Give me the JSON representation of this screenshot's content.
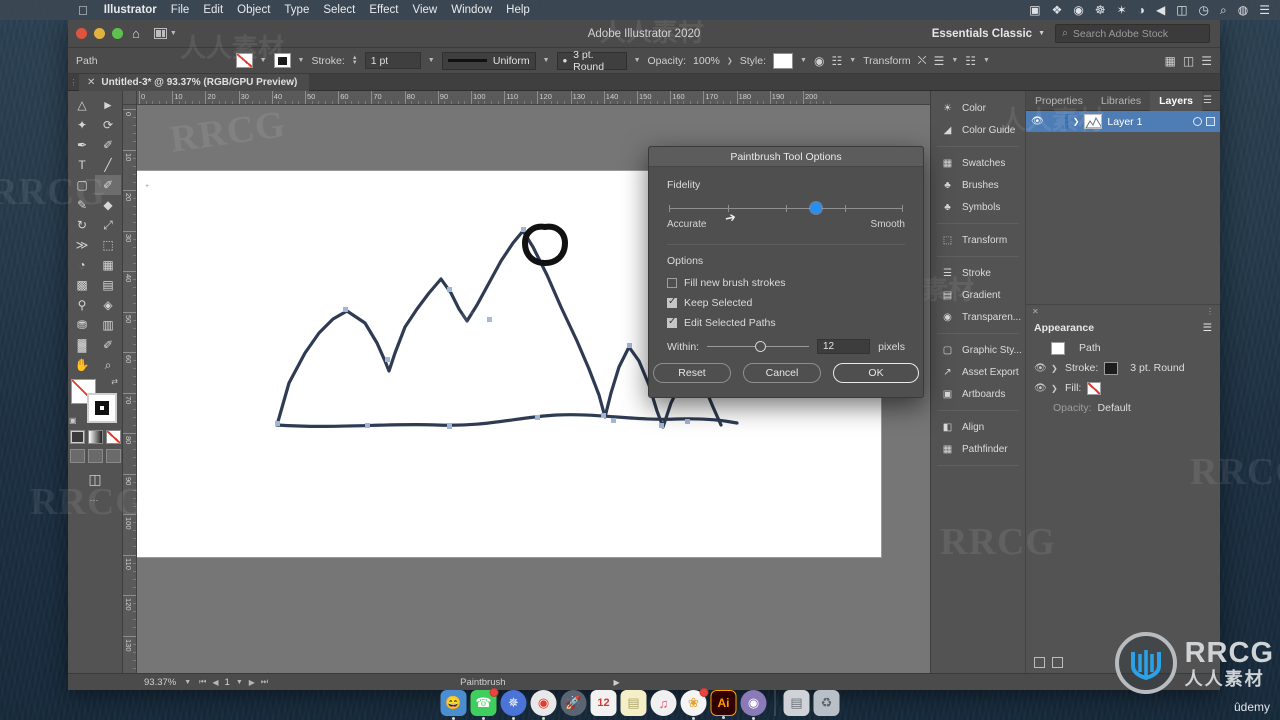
{
  "menubar": {
    "apple_icon": "apple-icon",
    "items": [
      {
        "label": "Illustrator",
        "bold": true
      },
      {
        "label": "File",
        "bold": false
      },
      {
        "label": "Edit",
        "bold": false
      },
      {
        "label": "Object",
        "bold": false
      },
      {
        "label": "Type",
        "bold": false
      },
      {
        "label": "Select",
        "bold": false
      },
      {
        "label": "Effect",
        "bold": false
      },
      {
        "label": "View",
        "bold": false
      },
      {
        "label": "Window",
        "bold": false
      },
      {
        "label": "Help",
        "bold": false
      }
    ],
    "status_icons": [
      {
        "name": "screen-record-icon",
        "glyph": "■"
      },
      {
        "name": "dropbox-icon",
        "glyph": "❖"
      },
      {
        "name": "app-icon",
        "glyph": "●"
      },
      {
        "name": "spiral-icon",
        "glyph": "◎"
      },
      {
        "name": "bluetooth-icon",
        "glyph": "✶"
      },
      {
        "name": "wifi-icon",
        "glyph": "◗"
      },
      {
        "name": "volume-icon",
        "glyph": "◀"
      },
      {
        "name": "battery-icon",
        "glyph": "▭"
      },
      {
        "name": "clock-icon",
        "glyph": "◷"
      },
      {
        "name": "search-icon",
        "glyph": "⌕"
      },
      {
        "name": "siri-icon",
        "glyph": "◍"
      },
      {
        "name": "control-center-icon",
        "glyph": "☰"
      }
    ]
  },
  "titlebar": {
    "title": "Adobe Illustrator 2020",
    "workspace": "Essentials Classic",
    "search_placeholder": "Search Adobe Stock",
    "home_icon": "home-icon",
    "arrange_icon": "arrange-documents-icon"
  },
  "controlbar": {
    "selection_label": "Path",
    "fill_swatch": "fill-none-swatch",
    "stroke_swatch": "stroke-black-swatch",
    "stroke_label": "Stroke:",
    "stroke_weight": "1 pt",
    "profile_label": "Uniform",
    "brush_label": "3 pt. Round",
    "opacity_label": "Opacity:",
    "opacity_value": "100%",
    "style_label": "Style:",
    "transform_label": "Transform",
    "recolor_icon": "recolor-artwork-icon",
    "select_similar_icon": "select-similar-icon",
    "align_icon": "align-icon",
    "distribute_icon": "distribute-icon",
    "arrange_icon": "arrange-icon",
    "more_options_icon": "more-options-icon"
  },
  "doctab": {
    "close_icon": "close-tab-icon",
    "label": "Untitled-3* @ 93.37% (RGB/GPU Preview)"
  },
  "toolbar": {
    "tools": [
      {
        "name": "selection-tool",
        "glyph": "◤"
      },
      {
        "name": "direct-selection-tool",
        "glyph": "◥"
      },
      {
        "name": "magic-wand-tool",
        "glyph": "✦"
      },
      {
        "name": "lasso-tool",
        "glyph": "◠"
      },
      {
        "name": "pen-tool",
        "glyph": "✒"
      },
      {
        "name": "curvature-tool",
        "glyph": "✐"
      },
      {
        "name": "type-tool",
        "glyph": "T"
      },
      {
        "name": "line-segment-tool",
        "glyph": "╱"
      },
      {
        "name": "rectangle-tool",
        "glyph": "▭"
      },
      {
        "name": "paintbrush-tool",
        "glyph": "🖌"
      },
      {
        "name": "shaper-tool",
        "glyph": "✎"
      },
      {
        "name": "eraser-tool",
        "glyph": "◆"
      },
      {
        "name": "rotate-tool",
        "glyph": "↻"
      },
      {
        "name": "scale-tool",
        "glyph": "⤡"
      },
      {
        "name": "width-tool",
        "glyph": "≶"
      },
      {
        "name": "free-transform-tool",
        "glyph": "⬚"
      },
      {
        "name": "shape-builder-tool",
        "glyph": "◔"
      },
      {
        "name": "perspective-grid-tool",
        "glyph": "▦"
      },
      {
        "name": "mesh-tool",
        "glyph": "▩"
      },
      {
        "name": "gradient-tool",
        "glyph": "▤"
      },
      {
        "name": "eyedropper-tool",
        "glyph": "⚲"
      },
      {
        "name": "blend-tool",
        "glyph": "◉"
      },
      {
        "name": "symbol-sprayer-tool",
        "glyph": "⚱"
      },
      {
        "name": "column-graph-tool",
        "glyph": "▥"
      },
      {
        "name": "artboard-tool",
        "glyph": "⬓"
      },
      {
        "name": "slice-tool",
        "glyph": "✂"
      },
      {
        "name": "hand-tool",
        "glyph": "✋"
      },
      {
        "name": "zoom-tool",
        "glyph": "⌕"
      }
    ],
    "active_tool": "paintbrush-tool",
    "fill_stroke": {
      "fill_name": "fill-none-indicator",
      "stroke_name": "stroke-black-indicator",
      "swap_icon": "swap-fill-stroke-icon",
      "default_icon": "default-fill-stroke-icon"
    },
    "color_modes": [
      {
        "name": "color-mode-button"
      },
      {
        "name": "gradient-mode-button"
      },
      {
        "name": "none-mode-button"
      }
    ],
    "drawing_modes": [
      {
        "name": "draw-normal-button"
      },
      {
        "name": "draw-behind-button"
      },
      {
        "name": "draw-inside-button"
      }
    ],
    "screen_mode_icon": "change-screen-mode-icon",
    "edit_toolbar_icon": "edit-toolbar-dots-icon"
  },
  "rulers": {
    "top_ticks": [
      "0",
      "10",
      "20",
      "30",
      "40",
      "50",
      "60",
      "70",
      "80",
      "90",
      "100",
      "110",
      "120",
      "130",
      "140",
      "150",
      "160",
      "170",
      "180",
      "190",
      "200"
    ],
    "left_ticks": [
      "0",
      "10",
      "20",
      "30",
      "40",
      "50",
      "60",
      "70",
      "80",
      "90",
      "100",
      "110",
      "120",
      "130"
    ]
  },
  "artboard": {
    "origin_marker": "+",
    "artwork_name": "mountain-landscape-path",
    "zoom": "93.37%"
  },
  "icon_dock": {
    "groups": [
      [
        {
          "label": "Color",
          "icon": "color-panel-icon"
        },
        {
          "label": "Color Guide",
          "icon": "color-guide-panel-icon"
        }
      ],
      [
        {
          "label": "Swatches",
          "icon": "swatches-panel-icon"
        },
        {
          "label": "Brushes",
          "icon": "brushes-panel-icon"
        },
        {
          "label": "Symbols",
          "icon": "symbols-panel-icon"
        }
      ],
      [
        {
          "label": "Transform",
          "icon": "transform-panel-icon"
        }
      ],
      [
        {
          "label": "Stroke",
          "icon": "stroke-panel-icon"
        },
        {
          "label": "Gradient",
          "icon": "gradient-panel-icon"
        },
        {
          "label": "Transparen...",
          "icon": "transparency-panel-icon"
        }
      ],
      [
        {
          "label": "Graphic Sty...",
          "icon": "graphic-styles-panel-icon"
        },
        {
          "label": "Asset Export",
          "icon": "asset-export-panel-icon"
        },
        {
          "label": "Artboards",
          "icon": "artboards-panel-icon"
        }
      ],
      [
        {
          "label": "Align",
          "icon": "align-panel-icon"
        },
        {
          "label": "Pathfinder",
          "icon": "pathfinder-panel-icon"
        }
      ]
    ]
  },
  "layers_panel": {
    "tabs": [
      {
        "label": "Properties",
        "active": false
      },
      {
        "label": "Libraries",
        "active": false
      },
      {
        "label": "Layers",
        "active": true
      }
    ],
    "menu_icon": "panel-menu-icon",
    "layer": {
      "name": "Layer 1",
      "visibility_icon": "eye-icon",
      "expand_icon": "chevron-right-icon",
      "thumbnail": "layer-thumbnail",
      "target_icon": "target-circle-icon",
      "select_icon": "selection-square-icon"
    }
  },
  "appearance_panel": {
    "close_icon": "close-panel-icon",
    "collapse_icon": "collapse-panel-icon",
    "title": "Appearance",
    "menu_icon": "panel-menu-icon",
    "object_label": "Path",
    "rows": [
      {
        "label": "Stroke:",
        "value": "3 pt. Round",
        "swatch": "black"
      },
      {
        "label": "Fill:",
        "value": "",
        "swatch": "none"
      }
    ],
    "opacity_label": "Opacity:",
    "opacity_value": "Default",
    "footer_icons": [
      "add-new-stroke-icon",
      "add-new-fill-icon"
    ]
  },
  "statusbar": {
    "zoom": "93.37%",
    "artboard_number": "1",
    "tool_name": "Paintbrush",
    "first_icon": "first-artboard-icon",
    "prev_icon": "prev-artboard-icon",
    "next_icon": "next-artboard-icon",
    "last_icon": "last-artboard-icon",
    "expand_icon": "expand-status-icon"
  },
  "dialog": {
    "title": "Paintbrush Tool Options",
    "fidelity": {
      "section_label": "Fidelity",
      "left_label": "Accurate",
      "right_label": "Smooth",
      "value_percent": 63,
      "knob_color": "#2a8ef0"
    },
    "options": {
      "section_label": "Options",
      "checkboxes": [
        {
          "label": "Fill new brush strokes",
          "checked": false
        },
        {
          "label": "Keep Selected",
          "checked": true
        },
        {
          "label": "Edit Selected Paths",
          "checked": true
        }
      ],
      "within_label": "Within:",
      "within_value": "12",
      "within_unit": "pixels",
      "within_percent": 52
    },
    "buttons": [
      {
        "label": "Reset",
        "primary": false
      },
      {
        "label": "Cancel",
        "primary": false
      },
      {
        "label": "OK",
        "primary": true
      }
    ],
    "cursor_icon": "mouse-pointer-cursor"
  },
  "watermarks": {
    "latin": "RRCG",
    "chinese": "人人素材"
  },
  "dock": {
    "items": [
      {
        "name": "finder-icon",
        "glyph": "🙂",
        "bg": "#4a8ed0",
        "running": true,
        "badge": false
      },
      {
        "name": "whatsapp-icon",
        "glyph": "✆",
        "bg": "#3fcf5e",
        "running": true,
        "badge": true
      },
      {
        "name": "safari-icon",
        "glyph": "✵",
        "bg": "#4a74d8",
        "running": true,
        "badge": false
      },
      {
        "name": "chrome-icon",
        "glyph": "◉",
        "bg": "#e8e8e8",
        "running": true,
        "badge": false
      },
      {
        "name": "launchpad-icon",
        "glyph": "🚀",
        "bg": "#5b6472",
        "running": false,
        "badge": false
      },
      {
        "name": "calendar-icon",
        "glyph": "12",
        "bg": "#f2f2f2",
        "running": false,
        "badge": false
      },
      {
        "name": "notes-icon",
        "glyph": "▤",
        "bg": "#f5efc8",
        "running": false,
        "badge": false
      },
      {
        "name": "music-icon",
        "glyph": "♪",
        "bg": "#f0f0f0",
        "running": false,
        "badge": false
      },
      {
        "name": "photos-icon",
        "glyph": "❀",
        "bg": "#f4f4f4",
        "running": true,
        "badge": true
      },
      {
        "name": "illustrator-icon",
        "glyph": "Ai",
        "bg": "#310000",
        "running": true,
        "badge": false
      },
      {
        "name": "quicktime-icon",
        "glyph": "◎",
        "bg": "#8a7ab8",
        "running": true,
        "badge": false
      },
      {
        "name": "downloads-icon",
        "glyph": "▤",
        "bg": "#cfd3d8",
        "running": false,
        "badge": false
      },
      {
        "name": "trash-icon",
        "glyph": "🗑",
        "bg": "#b9bfc6",
        "running": false,
        "badge": false
      }
    ]
  },
  "brand": {
    "latin": "RRCG",
    "chinese": "人人素材",
    "platform": "ûdemy"
  }
}
